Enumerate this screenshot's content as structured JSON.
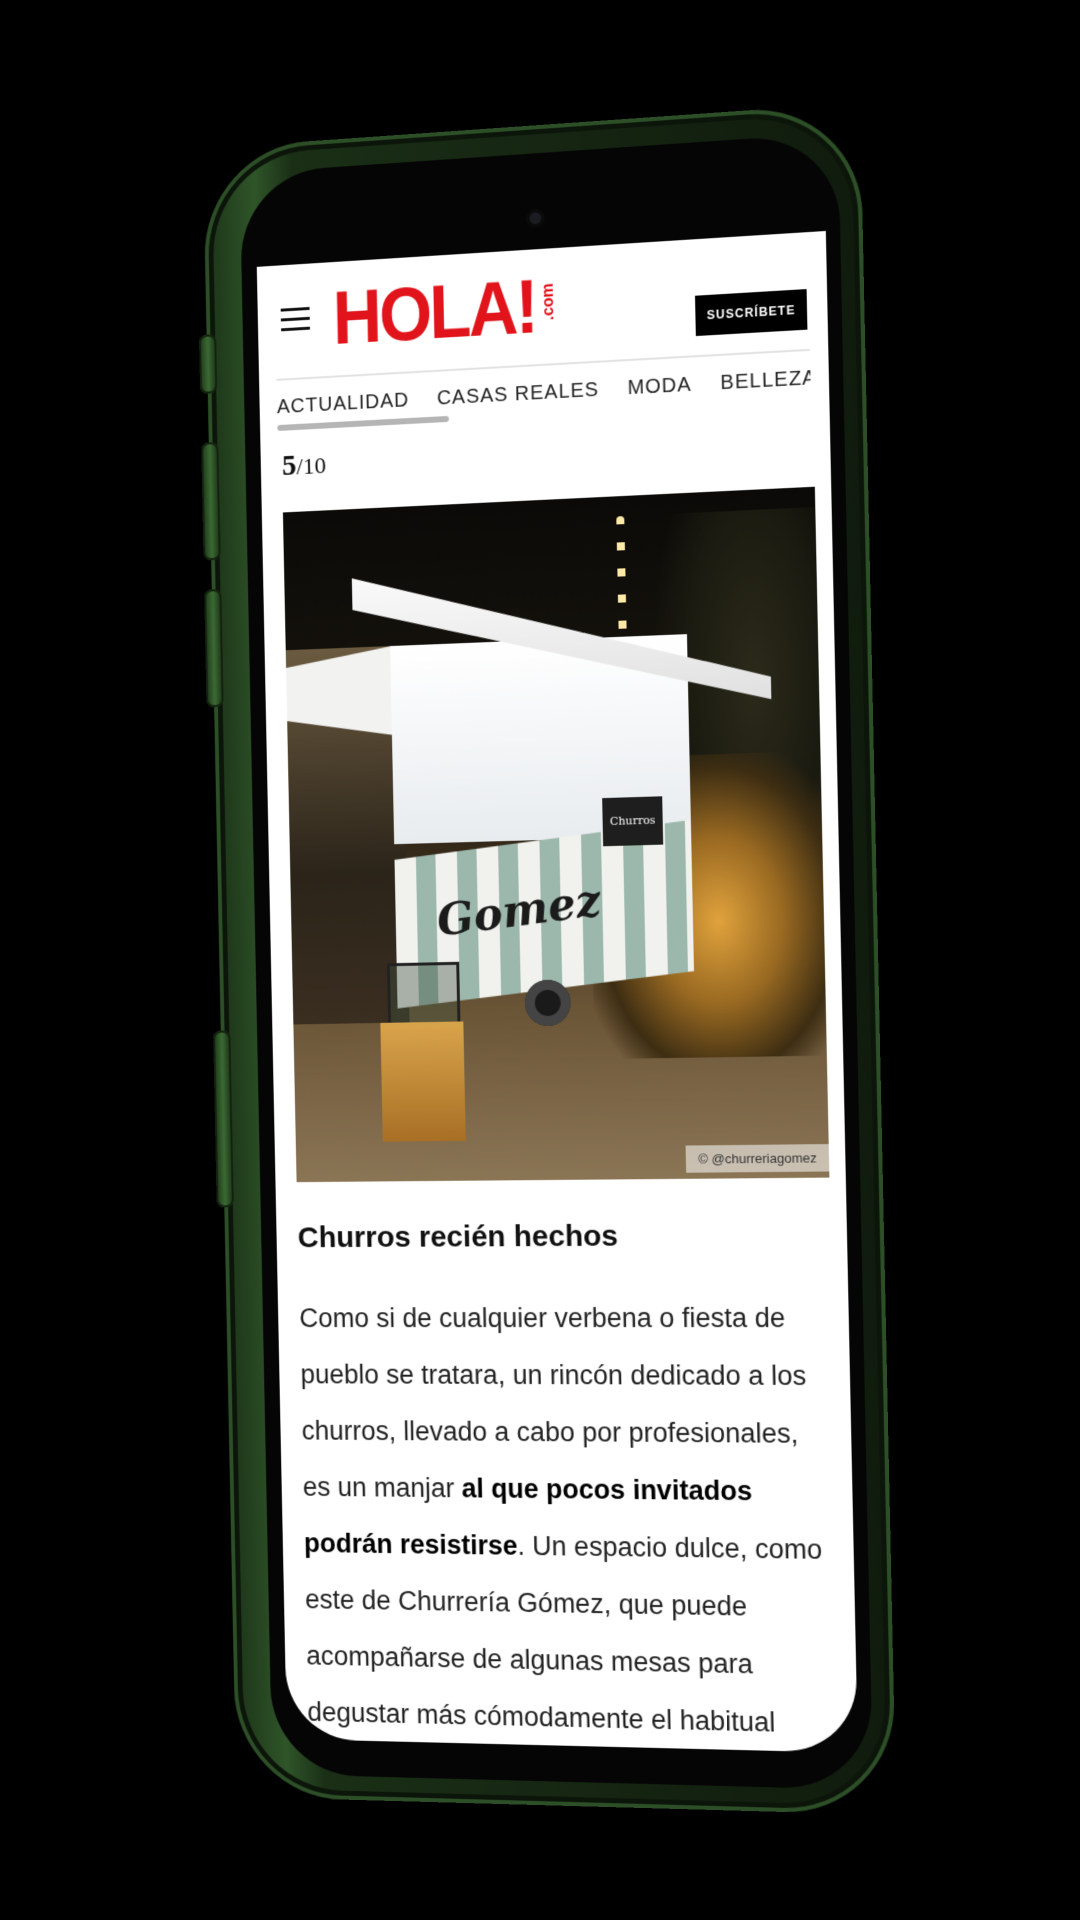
{
  "header": {
    "logo_text": "HOLA!",
    "logo_suffix": ".com",
    "subscribe_label": "SUSCRÍBETE"
  },
  "nav": {
    "items": [
      "ACTUALIDAD",
      "CASAS REALES",
      "MODA",
      "BELLEZA"
    ],
    "active_index": 0
  },
  "gallery": {
    "current": "5",
    "total": "/10"
  },
  "photo": {
    "brand_on_cart": "Gomez",
    "sign_text": "Churros",
    "credit": "© @churreriagomez"
  },
  "article": {
    "title": "Churros recién hechos",
    "body_part1": "Como si de cualquier verbena o fiesta de pueblo se tratara, un rincón dedicado a los churros, llevado a cabo por profesionales, es un manjar ",
    "body_bold": "al que pocos invitados podrán resistirse",
    "body_part2": ". Un espacio dulce, como este de Churrería Gómez, que puede acompañarse de algunas mesas para degustar más cómodamente el habitual chocolate"
  },
  "colors": {
    "brand_red": "#e1141b",
    "phone_green": "#2f5529",
    "background": "#000000"
  }
}
